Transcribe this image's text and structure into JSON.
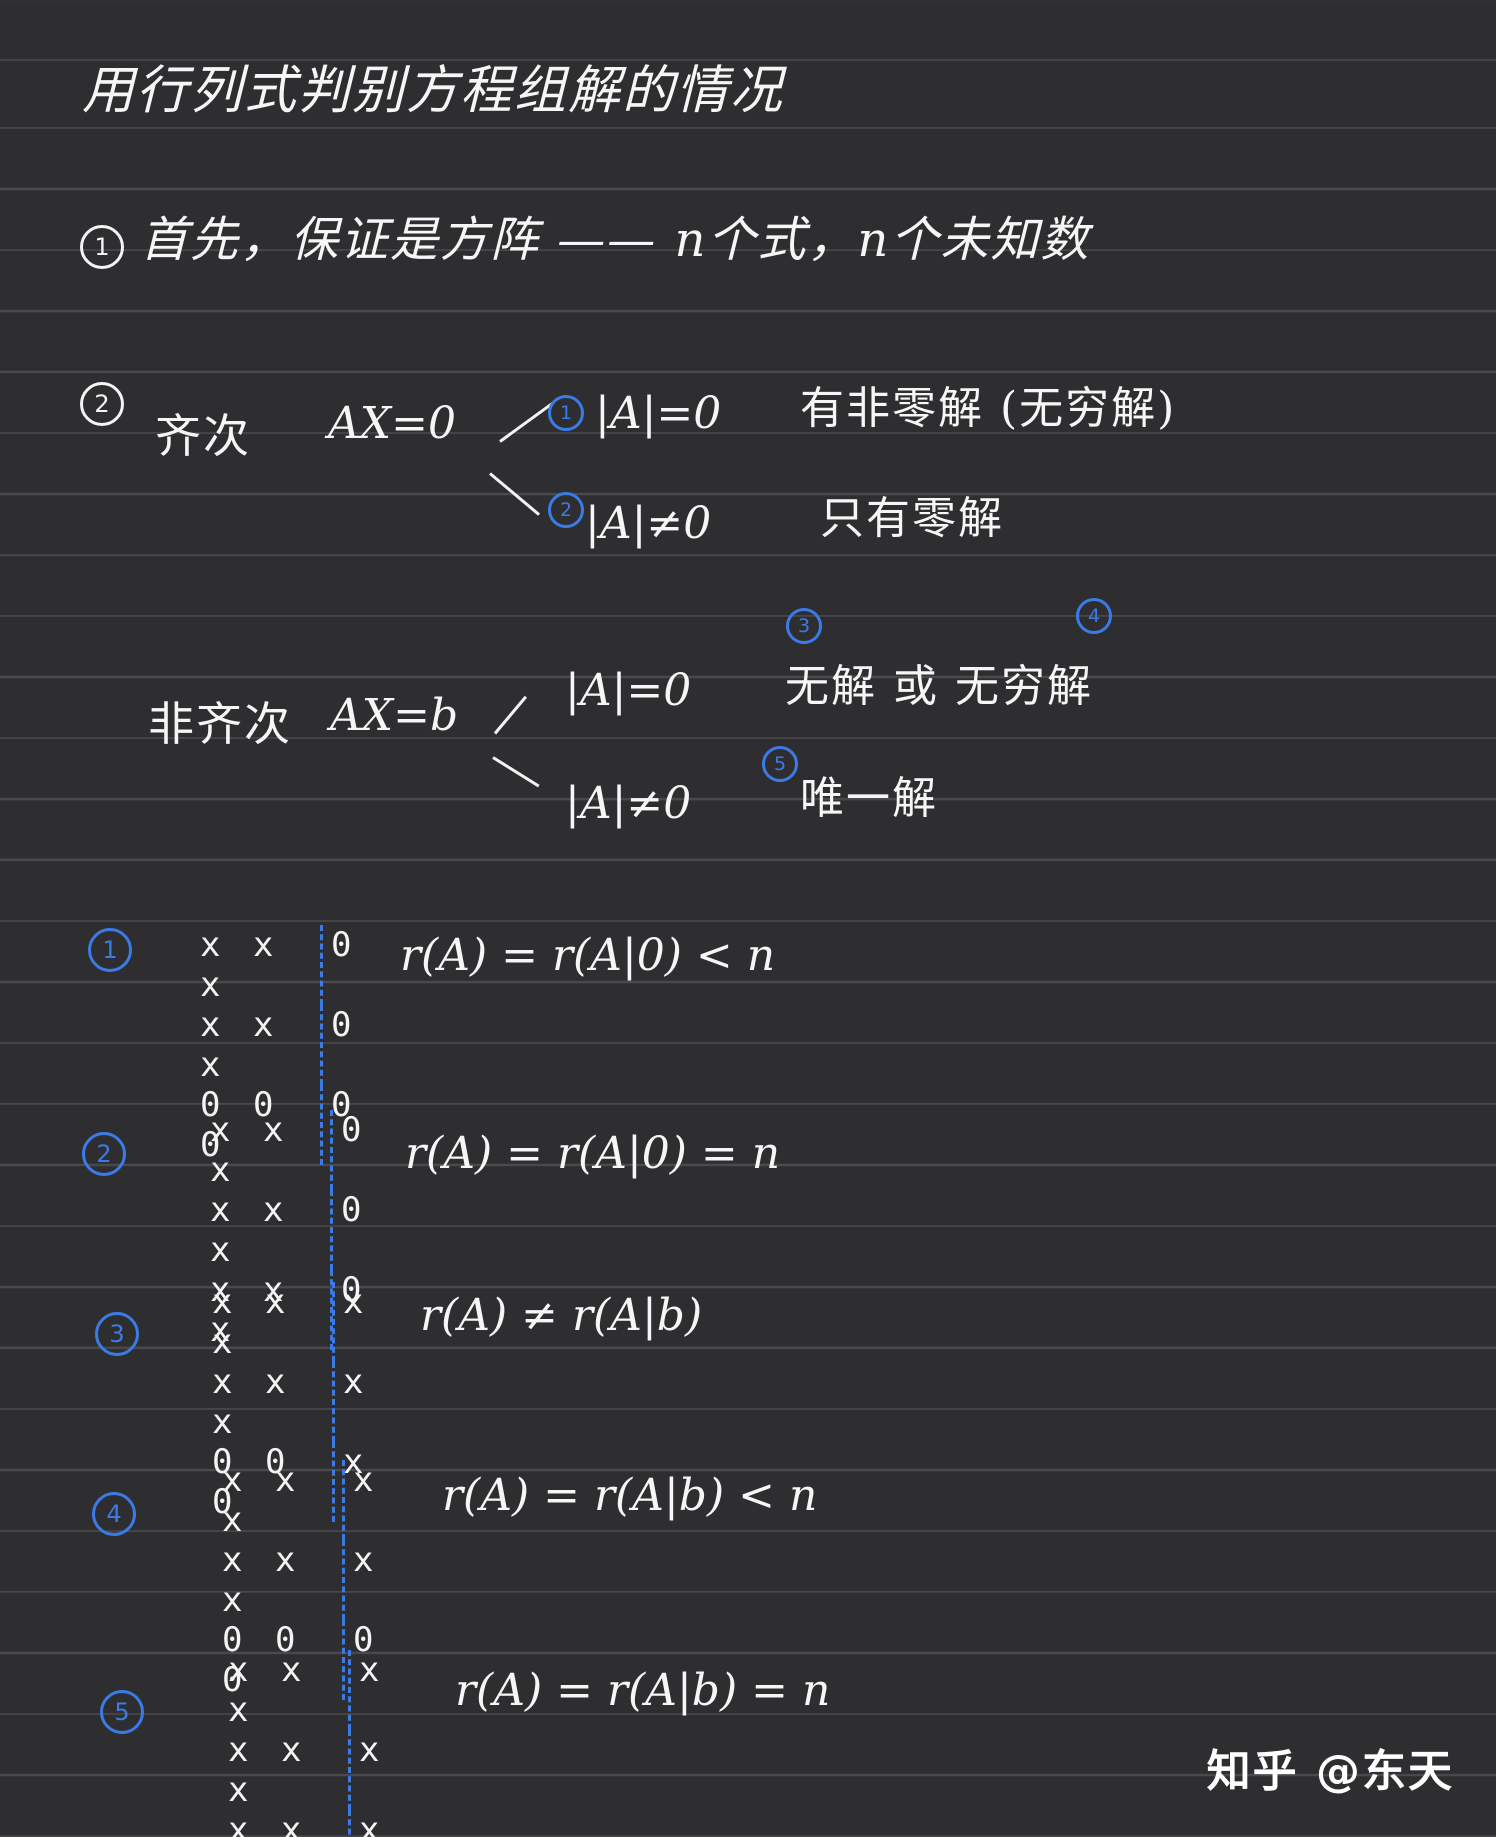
{
  "title": "用行列式判别方程组解的情况",
  "point1": {
    "marker": "1",
    "text": "首先，保证是方阵 —— n个式，n个未知数"
  },
  "point2": {
    "marker": "2",
    "homogeneous": {
      "label": "齐次",
      "equation": "AX=0",
      "cases": [
        {
          "marker": "1",
          "condition": "|A|=0",
          "result": "有非零解 (无穷解)"
        },
        {
          "marker": "2",
          "condition": "|A|≠0",
          "result": "只有零解"
        }
      ]
    },
    "nonhomogeneous": {
      "label": "非齐次",
      "equation": "AX=b",
      "cases": [
        {
          "markers": [
            "3",
            "4"
          ],
          "condition": "|A|=0",
          "result": "无解 或 无穷解"
        },
        {
          "marker": "5",
          "condition": "|A|≠0",
          "result": "唯一解"
        }
      ]
    }
  },
  "examples": [
    {
      "marker": "1",
      "rows": [
        [
          "x x x",
          "0"
        ],
        [
          "x x x",
          "0"
        ],
        [
          "0 0 0",
          "0"
        ]
      ],
      "relation": "r(A) = r(A|0) < n"
    },
    {
      "marker": "2",
      "rows": [
        [
          "x x x",
          "0"
        ],
        [
          "x x x",
          "0"
        ],
        [
          "x x x",
          "0"
        ]
      ],
      "relation": "r(A) = r(A|0) = n"
    },
    {
      "marker": "3",
      "rows": [
        [
          "x x x",
          "x"
        ],
        [
          "x x x",
          "x"
        ],
        [
          "0 0 0",
          "x"
        ]
      ],
      "relation": "r(A) ≠ r(A|b)"
    },
    {
      "marker": "4",
      "rows": [
        [
          "x x x",
          "x"
        ],
        [
          "x x x",
          "x"
        ],
        [
          "0 0 0",
          "0"
        ]
      ],
      "relation": "r(A) = r(A|b) < n"
    },
    {
      "marker": "5",
      "rows": [
        [
          "x x x",
          "x"
        ],
        [
          "x x x",
          "x"
        ],
        [
          "x x x",
          "x"
        ]
      ],
      "relation": "r(A) = r(A|b) = n"
    }
  ],
  "watermark": "知乎 @东天",
  "colors": {
    "background": "#2e2e30",
    "ink": "#f6f6f6",
    "accent": "#3b7be8",
    "rule": "#4a4a4d"
  }
}
